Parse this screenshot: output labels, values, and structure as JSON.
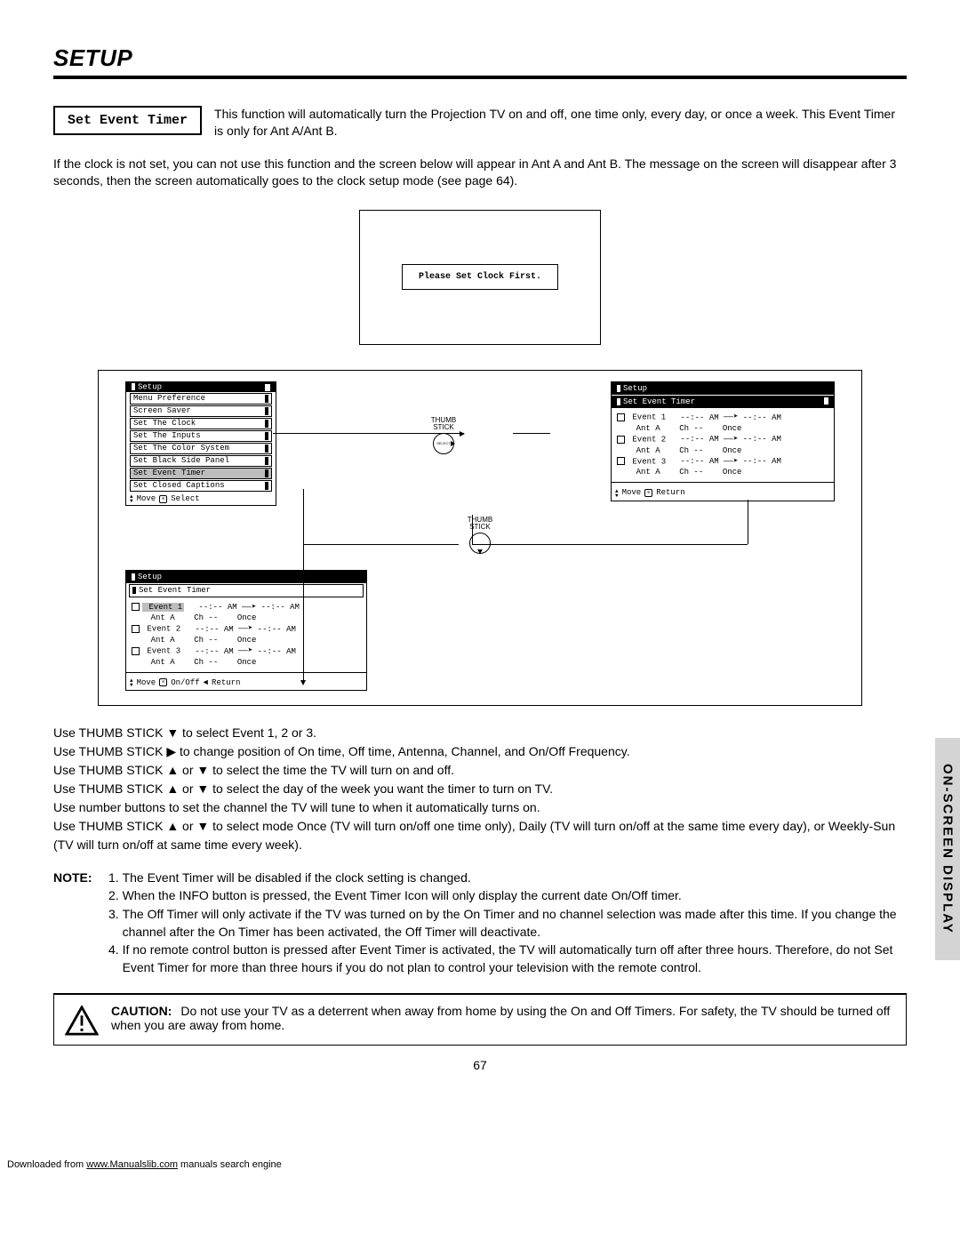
{
  "title": "SETUP",
  "labelBox": "Set Event Timer",
  "intro": "This function will automatically turn the Projection TV on and off, one time only, every day, or once a week.  This Event Timer is only for Ant A/Ant B.",
  "clockPara": "If the clock is not set, you can not use this function and the screen below will appear in Ant A and Ant B.  The message on the screen will disappear after 3 seconds, then the screen automatically goes to the clock setup mode (see page 64).",
  "clockMsg": "Please Set Clock First.",
  "thumbLabel": "THUMB\nSTICK",
  "menu1": {
    "header": "Setup",
    "items": [
      "Menu Preference",
      "Screen Saver",
      "Set The Clock",
      "Set The Inputs",
      "Set The Color System",
      "Set Black Side Panel",
      "Set Event Timer",
      "Set Closed Captions"
    ],
    "selected": "Set Event Timer",
    "footer": "Move      Select"
  },
  "menu2": {
    "header": "Setup",
    "sub": "Set Event Timer",
    "rows": [
      {
        "label": "Event 1",
        "time": "--:-- AM",
        "arrow": "→",
        "time2": "--:-- AM"
      },
      {
        "label": "Ant A",
        "ch": "Ch --",
        "freq": "Once"
      },
      {
        "label": "Event 2",
        "time": "--:-- AM",
        "arrow": "→",
        "time2": "--:-- AM"
      },
      {
        "label": "Ant A",
        "ch": "Ch --",
        "freq": "Once"
      },
      {
        "label": "Event 3",
        "time": "--:-- AM",
        "arrow": "→",
        "time2": "--:-- AM"
      },
      {
        "label": "Ant A",
        "ch": "Ch --",
        "freq": "Once"
      }
    ],
    "footer": "Move      Return"
  },
  "menu3": {
    "header": "Setup",
    "sub": "Set Event Timer",
    "rows": [
      {
        "label": "Event 1",
        "sel": true,
        "time": "--:-- AM",
        "arrow": "→",
        "time2": "--:-- AM"
      },
      {
        "label": "Ant A",
        "ch": "Ch --",
        "freq": "Once"
      },
      {
        "label": "Event 2",
        "time": "--:-- AM",
        "arrow": "→",
        "time2": "--:-- AM"
      },
      {
        "label": "Ant A",
        "ch": "Ch --",
        "freq": "Once"
      },
      {
        "label": "Event 3",
        "time": "--:-- AM",
        "arrow": "→",
        "time2": "--:-- AM"
      },
      {
        "label": "Ant A",
        "ch": "Ch --",
        "freq": "Once"
      }
    ],
    "footer": "Move      On/Off ◄ Return"
  },
  "instr": [
    "Use THUMB STICK ▼ to select Event 1, 2 or 3.",
    "Use THUMB STICK ▶ to change position of On time, Off time, Antenna, Channel, and On/Off Frequency.",
    "Use THUMB STICK ▲ or ▼ to select the time the TV will turn on and off.",
    "Use THUMB STICK ▲ or ▼ to select the day of the week you want the timer to turn on TV.",
    "Use number buttons to set the channel the TV will tune to when it automatically turns on.",
    "Use THUMB STICK ▲ or ▼ to select mode Once (TV will turn on/off one time only), Daily (TV will turn on/off at the same time every day), or Weekly-Sun (TV will turn on/off at same time every week)."
  ],
  "noteLabel": "NOTE:",
  "notes": [
    "The Event Timer will be disabled if the clock setting is changed.",
    "When the INFO button is pressed, the Event Timer Icon will only display the current date On/Off timer.",
    "The Off Timer will only activate if the TV was turned on by the On Timer and no channel selection was made after this time.  If you change the channel after the On Timer has been activated, the Off Timer will deactivate.",
    "If no remote control button is pressed after Event Timer is activated, the TV will automatically turn off after three hours.  Therefore, do not Set Event Timer for more than three hours if you do not plan to control your television with the remote control."
  ],
  "cautionLabel": "CAUTION:",
  "caution": "Do not use your TV as a deterrent when away from home by using the On and Off Timers.  For safety, the TV should be turned off when you are away from home.",
  "pageNum": "67",
  "sideTab": "ON-SCREEN DISPLAY",
  "footer": {
    "pre": "Downloaded from ",
    "link": "www.Manualslib.com",
    "post": " manuals search engine"
  }
}
